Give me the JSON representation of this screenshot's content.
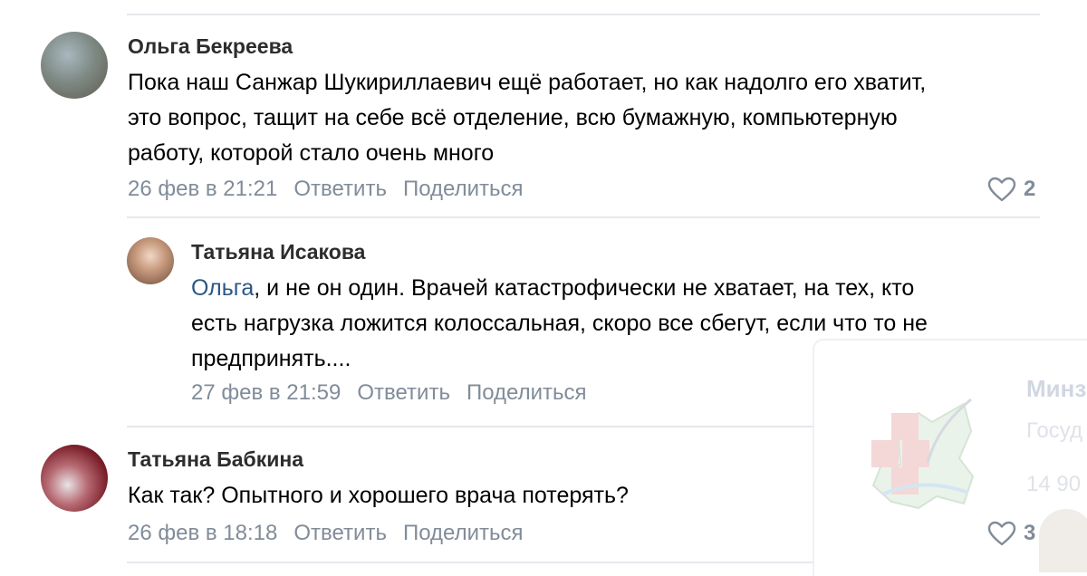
{
  "comments": [
    {
      "author": "Ольга Бекреева",
      "lines": [
        "Пока наш Санжар Шукириллаевич ещё работает, но как надолго его хватит,",
        "это вопрос, тащит на себе всё отделение, всю бумажную, компьютерную",
        "работу, которой стало очень много"
      ],
      "date": "26 фев в 21:21",
      "reply_label": "Ответить",
      "share_label": "Поделиться",
      "likes": "2",
      "avatar_color": "#7f8a84"
    },
    {
      "author": "Татьяна Исакова",
      "mention": "Ольга",
      "lines": [
        ", и не он один. Врачей катастрофически не хватает, на тех, кто",
        "есть нагрузка ложится колоссальная, скоро все сбегут, если что то не",
        "предпринять...."
      ],
      "date": "27 фев в 21:59",
      "reply_label": "Ответить",
      "share_label": "Поделиться",
      "avatar_color": "#b58a6c"
    },
    {
      "author": "Татьяна Бабкина",
      "lines": [
        "Как так? Опытного и хорошего врача потерять?"
      ],
      "date": "26 фев в 18:18",
      "reply_label": "Ответить",
      "share_label": "Поделиться",
      "likes": "3",
      "avatar_color": "#8a2a34"
    }
  ],
  "widget": {
    "title": "Минз",
    "subtitle": "Госуд",
    "count": "14 90"
  },
  "colors": {
    "link": "#2a5885",
    "meta": "#818c99",
    "divider": "#e7e8ec"
  }
}
